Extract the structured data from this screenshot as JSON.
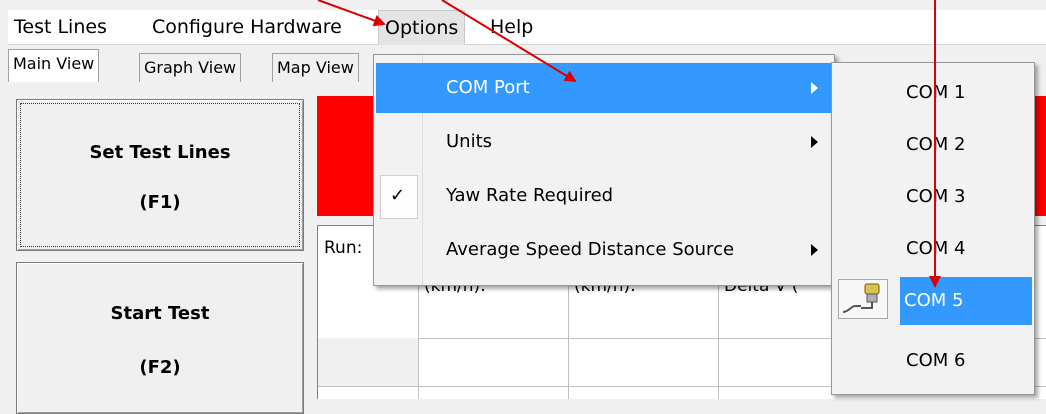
{
  "menubar": {
    "items": [
      "Test Lines",
      "Configure Hardware",
      "Options",
      "Help"
    ]
  },
  "tabs": [
    "Main View",
    "Graph View",
    "Map View"
  ],
  "buttons": {
    "set_test_lines": {
      "label": "Set Test Lines",
      "key": "(F1)"
    },
    "start_test": {
      "label": "Start Test",
      "key": "(F2)"
    }
  },
  "grid": {
    "run_label": "Run:",
    "headers": [
      "(km/h):",
      "(km/h):",
      "Delta V ("
    ]
  },
  "options_menu": {
    "items": [
      {
        "label": "COM Port",
        "submenu": true,
        "highlighted": true
      },
      {
        "label": "Units",
        "submenu": true
      },
      {
        "label": "Yaw Rate Required",
        "checked": true
      },
      {
        "label": "Average Speed Distance Source",
        "submenu": true
      }
    ]
  },
  "com_menu": {
    "items": [
      "COM 1",
      "COM 2",
      "COM 3",
      "COM 4",
      "COM 5",
      "COM 6"
    ],
    "selected": "COM 5"
  },
  "colors": {
    "highlight": "#3399ff",
    "status_bar": "#ff0000",
    "annotation_arrow": "#dd0000"
  },
  "icons": {
    "checkmark": "check-icon",
    "submenu": "submenu-arrow-icon",
    "com_port_device": "serial-cable-icon"
  }
}
